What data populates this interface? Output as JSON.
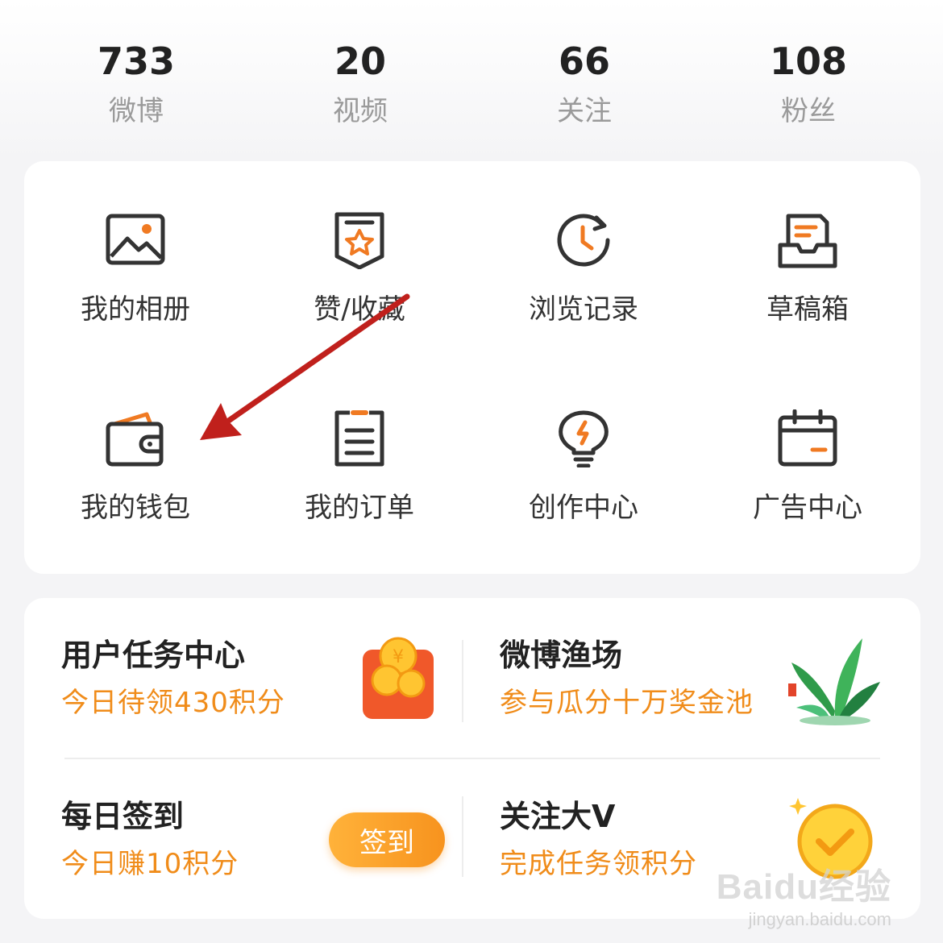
{
  "stats": [
    {
      "value": "733",
      "label": "微博"
    },
    {
      "value": "20",
      "label": "视频"
    },
    {
      "value": "66",
      "label": "关注"
    },
    {
      "value": "108",
      "label": "粉丝"
    }
  ],
  "grid": [
    {
      "label": "我的相册",
      "icon": "photo-album-icon"
    },
    {
      "label": "赞/收藏",
      "icon": "star-bookmark-icon"
    },
    {
      "label": "浏览记录",
      "icon": "history-clock-icon"
    },
    {
      "label": "草稿箱",
      "icon": "drafts-tray-icon"
    },
    {
      "label": "我的钱包",
      "icon": "wallet-icon"
    },
    {
      "label": "我的订单",
      "icon": "order-clipboard-icon"
    },
    {
      "label": "创作中心",
      "icon": "lightbulb-icon"
    },
    {
      "label": "广告中心",
      "icon": "calendar-icon"
    }
  ],
  "tasks": {
    "user_task": {
      "title": "用户任务中心",
      "subtitle": "今日待领430积分",
      "icon": "coin-redpacket-icon"
    },
    "fishery": {
      "title": "微博渔场",
      "subtitle": "参与瓜分十万奖金池",
      "icon": "plant-icon"
    },
    "checkin": {
      "title": "每日签到",
      "subtitle": "今日赚10积分",
      "button": "签到"
    },
    "follow_v": {
      "title": "关注大V",
      "subtitle": "完成任务领积分",
      "icon": "gold-check-coin-icon"
    }
  },
  "watermark": {
    "main": "Baidu经验",
    "sub": "jingyan.baidu.com"
  },
  "colors": {
    "accent": "#f08c1a",
    "icon_stroke": "#333333",
    "annotation_arrow": "#c0201c"
  }
}
